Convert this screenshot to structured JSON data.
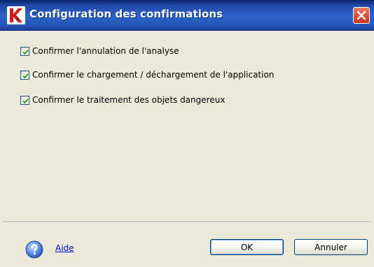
{
  "window": {
    "title": "Configuration des confirmations",
    "logo_icon": "kaspersky-k-icon",
    "close_icon": "close-icon"
  },
  "options": [
    {
      "label": "Confirmer l'annulation de l'analyse",
      "checked": true
    },
    {
      "label": "Confirmer le chargement / déchargement de l'application",
      "checked": true
    },
    {
      "label": "Confirmer le traitement des objets dangereux",
      "checked": true
    }
  ],
  "footer": {
    "help_icon": "help-icon",
    "help_label": "Aide",
    "ok_label": "OK",
    "cancel_label": "Annuler"
  },
  "colors": {
    "titlebar": "#2454b6",
    "dialog_background": "#ece9d8",
    "check_mark": "#21a121",
    "link": "#0000cc"
  }
}
